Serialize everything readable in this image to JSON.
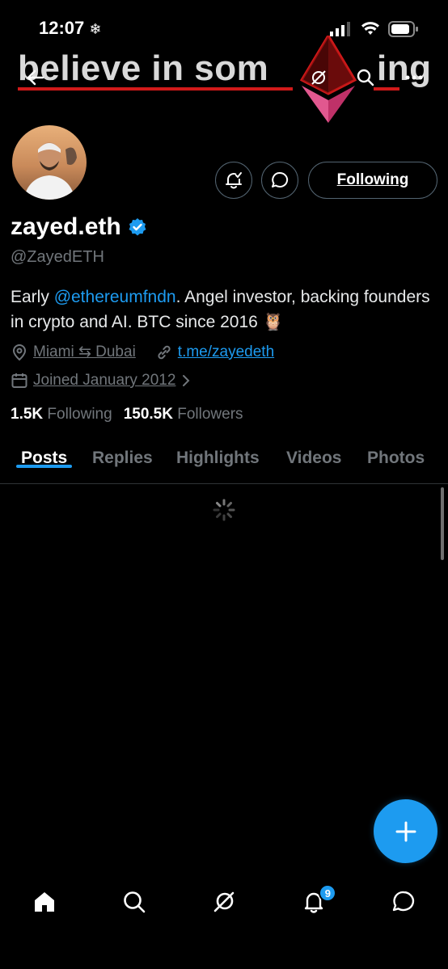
{
  "status_bar": {
    "time": "12:07",
    "snowflake_icon": "❄"
  },
  "header": {
    "banner_text": "believe in som",
    "banner_tail": "ing",
    "back_icon": "back-arrow-icon",
    "search_icon": "search-icon",
    "more_icon": "more-icon"
  },
  "profile": {
    "display_name": "zayed.eth",
    "handle": "@ZayedETH",
    "bio_prefix": "Early ",
    "bio_mention": "@ethereumfndn",
    "bio_suffix": ". Angel investor, backing founders in crypto and AI. BTC since 2016 🦉",
    "location": "Miami ⇆ Dubai",
    "website": "t.me/zayedeth",
    "joined": "Joined January 2012",
    "following_count": "1.5K",
    "following_label": "Following",
    "followers_count": "150.5K",
    "followers_label": "Followers",
    "follow_button": "Following"
  },
  "tabs": [
    {
      "label": "Posts",
      "active": true
    },
    {
      "label": "Replies",
      "active": false
    },
    {
      "label": "Highlights",
      "active": false
    },
    {
      "label": "Videos",
      "active": false
    },
    {
      "label": "Photos",
      "active": false
    }
  ],
  "bottom_nav": {
    "items": [
      "home-icon",
      "search-icon",
      "grok-icon",
      "bell-icon",
      "messages-icon"
    ],
    "notifications_badge": "9"
  },
  "colors": {
    "accent": "#1d9bf0",
    "muted": "#71767b",
    "background": "#000000"
  }
}
